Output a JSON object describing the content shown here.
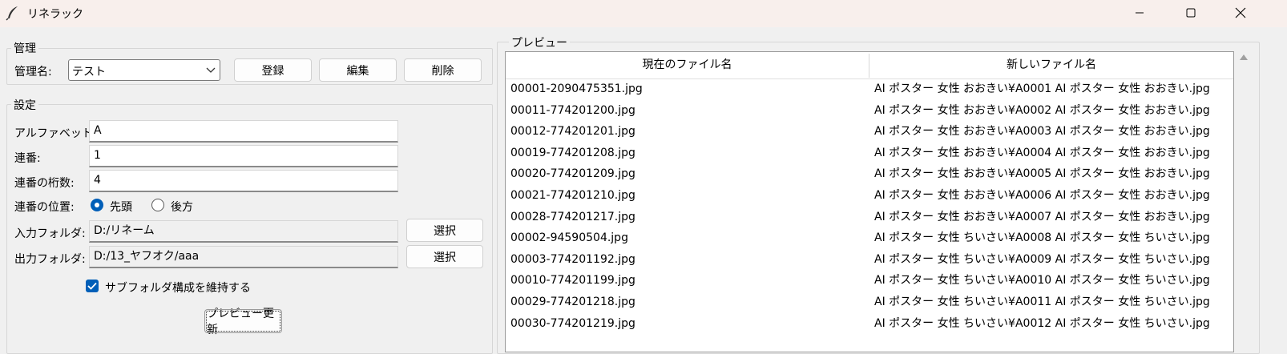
{
  "window": {
    "title": "リネラック"
  },
  "management": {
    "group_title": "管理",
    "name_label": "管理名:",
    "name_value": "テスト",
    "register_label": "登録",
    "edit_label": "編集",
    "delete_label": "削除"
  },
  "settings": {
    "group_title": "設定",
    "alphabet_label": "アルファベット:",
    "alphabet_value": "A",
    "seq_label": "連番:",
    "seq_value": "1",
    "digits_label": "連番の桁数:",
    "digits_value": "4",
    "position_label": "連番の位置:",
    "position_options": [
      "先頭",
      "後方"
    ],
    "position_selected": "先頭",
    "input_folder_label": "入力フォルダ:",
    "input_folder_value": "D:/リネーム",
    "output_folder_label": "出力フォルダ:",
    "output_folder_value": "D:/13_ヤフオク/aaa",
    "select_label": "選択",
    "keep_subfolders_label": "サブフォルダ構成を維持する",
    "keep_subfolders_checked": true,
    "preview_button_label": "プレビュー更新"
  },
  "preview": {
    "group_title": "プレビュー",
    "columns": [
      "現在のファイル名",
      "新しいファイル名"
    ],
    "rows": [
      [
        "00001-2090475351.jpg",
        "AI ポスター 女性 おおきい¥A0001 AI ポスター 女性 おおきい.jpg"
      ],
      [
        "00011-774201200.jpg",
        "AI ポスター 女性 おおきい¥A0002 AI ポスター 女性 おおきい.jpg"
      ],
      [
        "00012-774201201.jpg",
        "AI ポスター 女性 おおきい¥A0003 AI ポスター 女性 おおきい.jpg"
      ],
      [
        "00019-774201208.jpg",
        "AI ポスター 女性 おおきい¥A0004 AI ポスター 女性 おおきい.jpg"
      ],
      [
        "00020-774201209.jpg",
        "AI ポスター 女性 おおきい¥A0005 AI ポスター 女性 おおきい.jpg"
      ],
      [
        "00021-774201210.jpg",
        "AI ポスター 女性 おおきい¥A0006 AI ポスター 女性 おおきい.jpg"
      ],
      [
        "00028-774201217.jpg",
        "AI ポスター 女性 おおきい¥A0007 AI ポスター 女性 おおきい.jpg"
      ],
      [
        "00002-94590504.jpg",
        "AI ポスター 女性 ちいさい¥A0008 AI ポスター 女性 ちいさい.jpg"
      ],
      [
        "00003-774201192.jpg",
        "AI ポスター 女性 ちいさい¥A0009 AI ポスター 女性 ちいさい.jpg"
      ],
      [
        "00010-774201199.jpg",
        "AI ポスター 女性 ちいさい¥A0010 AI ポスター 女性 ちいさい.jpg"
      ],
      [
        "00029-774201218.jpg",
        "AI ポスター 女性 ちいさい¥A0011 AI ポスター 女性 ちいさい.jpg"
      ],
      [
        "00030-774201219.jpg",
        "AI ポスター 女性 ちいさい¥A0012 AI ポスター 女性 ちいさい.jpg"
      ]
    ]
  },
  "icons": {
    "app": "feather-icon",
    "minimize": "minimize-icon",
    "maximize": "maximize-icon",
    "close": "close-icon",
    "combo": "chevron-down-icon",
    "checkbox": "checkmark-icon",
    "scroll": "scroll-up-arrow-icon"
  },
  "colors": {
    "accent": "#005fb8",
    "titlebar": "#f8efec",
    "background": "#f0f0f0"
  }
}
